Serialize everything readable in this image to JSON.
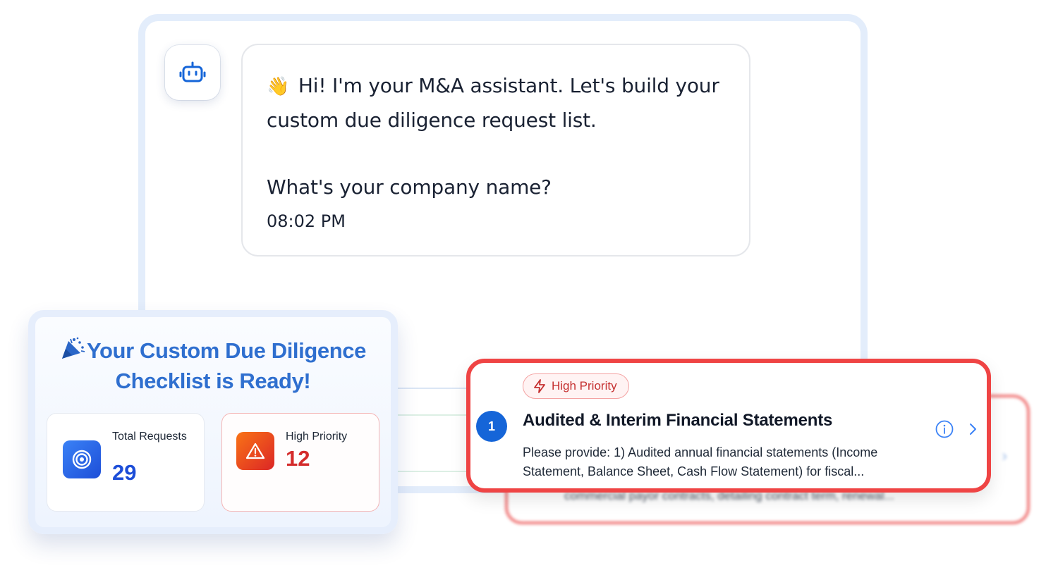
{
  "chat": {
    "greeting_emoji": "👋",
    "greeting_line1": "Hi! I'm your M&A assistant. Let's build your",
    "greeting_line2": "custom due diligence request list.",
    "question": "What's your company name?",
    "timestamp": "08:02 PM"
  },
  "checklist": {
    "title_line1": "Your Custom Due Diligence",
    "title_line2": "Checklist is Ready!",
    "title_icon": "party-popper-icon",
    "stats": {
      "total_label": "Total Requests",
      "total_value": "29",
      "high_label": "High Priority",
      "high_value": "12"
    }
  },
  "request": {
    "badge": "High Priority",
    "number": "1",
    "title": "Audited & Interim Financial Statements",
    "description": "Please provide: 1) Audited annual financial statements (Income Statement, Balance Sheet, Cash Flow Statement) for fiscal..."
  },
  "ghost_request": {
    "description": "commercial payor contracts, detailing contract term, renewal..."
  },
  "colors": {
    "accent_blue": "#1565d8",
    "title_blue": "#2f6fcf",
    "priority_red": "#ef4444"
  }
}
